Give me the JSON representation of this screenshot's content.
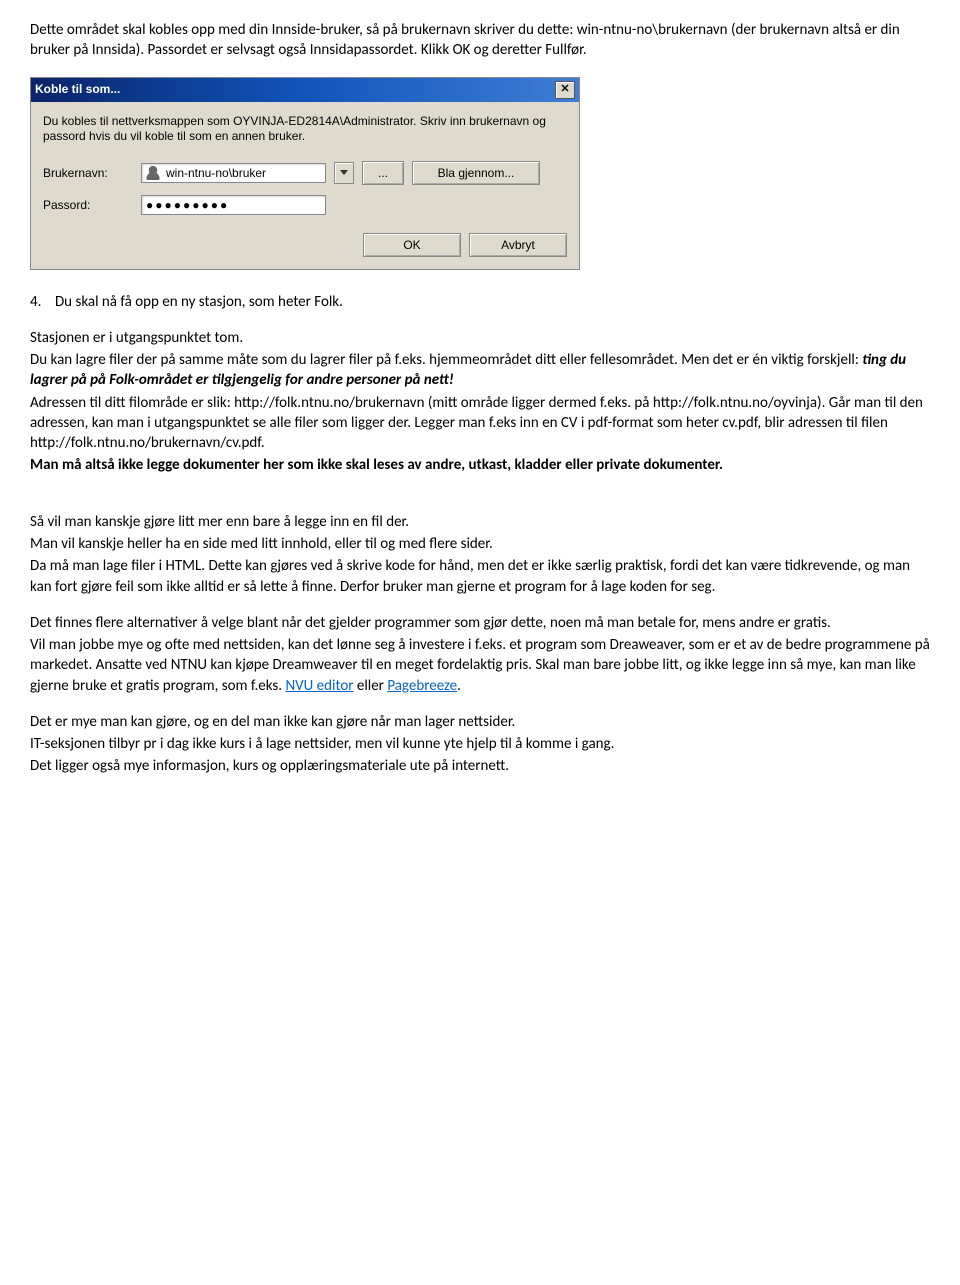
{
  "intro": {
    "p1a": "Dette området skal kobles opp med din Innside-bruker, så på brukernavn skriver du dette: win-ntnu-no\\brukernavn (der brukernavn altså er din bruker på Innsida). Passordet er selvsagt også Innsidapassordet. Klikk OK og deretter Fullfør."
  },
  "dialog": {
    "title": "Koble til som...",
    "desc": "Du kobles til nettverksmappen som OYVINJA-ED2814A\\Administrator. Skriv inn brukernavn og passord hvis du vil koble til som en annen bruker.",
    "username_label": "Brukernavn:",
    "username_value": "win-ntnu-no\\bruker",
    "browse": "Bla gjennom...",
    "ellipsis": "...",
    "password_label": "Passord:",
    "password_dots": "●●●●●●●●●",
    "ok": "OK",
    "cancel": "Avbryt",
    "close": "✕"
  },
  "step4": "4.    Du skal nå få opp en ny stasjon, som heter Folk.",
  "section1": {
    "l1": "Stasjonen er i utgangspunktet tom.",
    "l2": "Du kan lagre filer der på samme måte som du lagrer filer på f.eks. hjemmeområdet ditt eller fellesområdet. Men det er én viktig forskjell: ",
    "l2b": "ting du lagrer på på Folk-området er tilgjengelig for andre personer på nett!",
    "l3": "Adressen til ditt filområde er slik: http://folk.ntnu.no/brukernavn (mitt område ligger dermed f.eks. på http://folk.ntnu.no/oyvinja). Går man til den adressen, kan man i utgangspunktet se alle filer som ligger der. Legger man f.eks inn en CV i pdf-format som heter cv.pdf, blir adressen til filen http://folk.ntnu.no/brukernavn/cv.pdf.",
    "l4": "Man må altså ikke legge dokumenter her som ikke skal leses av andre, utkast, kladder eller private dokumenter."
  },
  "section2": {
    "l1": "Så vil man kanskje gjøre litt mer enn bare å legge inn en fil der.",
    "l2": "Man vil kanskje heller ha en side med litt innhold, eller til og med flere sider.",
    "l3": "Da må man lage filer i HTML. Dette kan gjøres ved å skrive kode for hånd, men det er ikke særlig praktisk, fordi det kan være tidkrevende, og man kan fort gjøre feil som ikke alltid er så lette å finne. Derfor bruker man gjerne et program for å lage koden for seg."
  },
  "section3": {
    "l1": "Det  finnes flere alternativer å velge blant når det gjelder programmer som gjør dette, noen må man betale for, mens andre er gratis.",
    "l2a": "Vil man jobbe mye og ofte med nettsiden, kan det lønne seg å investere i f.eks. et program som Dreaweaver, som er et av de bedre programmene på markedet. Ansatte ved NTNU kan kjøpe Dreamweaver til en meget fordelaktig pris. Skal man bare jobbe litt, og ikke legge inn så mye, kan man like gjerne bruke et gratis program, som f.eks. ",
    "link1": "NVU editor",
    "l2b": " eller ",
    "link2": "Pagebreeze",
    "l2c": "."
  },
  "section4": {
    "l1": "Det er mye man kan gjøre, og en del man ikke kan gjøre når man lager nettsider.",
    "l2": "IT-seksjonen tilbyr pr i dag ikke kurs i å lage nettsider, men vil kunne yte hjelp til å komme i gang.",
    "l3": "Det ligger også mye informasjon, kurs og opplæringsmateriale ute på internett."
  }
}
